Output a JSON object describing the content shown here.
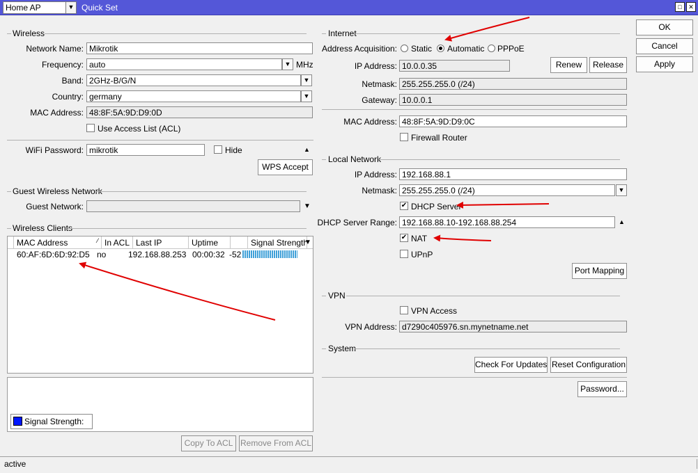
{
  "titlebar": {
    "mode": "Home AP",
    "title": "Quick Set"
  },
  "actions": {
    "ok": "OK",
    "cancel": "Cancel",
    "apply": "Apply"
  },
  "wireless": {
    "section": "Wireless",
    "network_name_label": "Network Name:",
    "network_name": "Mikrotik",
    "frequency_label": "Frequency:",
    "frequency": "auto",
    "frequency_unit": "MHz",
    "band_label": "Band:",
    "band": "2GHz-B/G/N",
    "country_label": "Country:",
    "country": "germany",
    "mac_label": "MAC Address:",
    "mac": "48:8F:5A:9D:D9:0D",
    "acl_label": "Use Access List (ACL)",
    "wifi_password_label": "WiFi Password:",
    "wifi_password": "mikrotik",
    "hide_label": "Hide",
    "wps_button": "WPS Accept"
  },
  "guest": {
    "section": "Guest Wireless Network",
    "network_label": "Guest Network:",
    "network": ""
  },
  "clients": {
    "section": "Wireless Clients",
    "columns": [
      "MAC Address",
      "In ACL",
      "Last IP",
      "Uptime",
      "",
      "Signal Strength"
    ],
    "rows": [
      {
        "mac": "60:AF:6D:6D:92:D5",
        "in_acl": "no",
        "last_ip": "192.168.88.253",
        "uptime": "00:00:32",
        "signal": "-52",
        "signal_bar": 0.9
      }
    ],
    "legend": "Signal Strength:",
    "copy_acl": "Copy To ACL",
    "remove_acl": "Remove From ACL"
  },
  "internet": {
    "section": "Internet",
    "acquisition_label": "Address Acquisition:",
    "options": [
      "Static",
      "Automatic",
      "PPPoE"
    ],
    "selected": "Automatic",
    "ip_label": "IP Address:",
    "ip": "10.0.0.35",
    "renew": "Renew",
    "release": "Release",
    "netmask_label": "Netmask:",
    "netmask": "255.255.255.0 (/24)",
    "gateway_label": "Gateway:",
    "gateway": "10.0.0.1",
    "mac_label": "MAC Address:",
    "mac": "48:8F:5A:9D:D9:0C",
    "firewall_label": "Firewall Router"
  },
  "local": {
    "section": "Local Network",
    "ip_label": "IP Address:",
    "ip": "192.168.88.1",
    "netmask_label": "Netmask:",
    "netmask": "255.255.255.0 (/24)",
    "dhcp_label": "DHCP Server",
    "dhcp_range_label": "DHCP Server Range:",
    "dhcp_range": "192.168.88.10-192.168.88.254",
    "nat_label": "NAT",
    "upnp_label": "UPnP",
    "port_mapping": "Port Mapping"
  },
  "vpn": {
    "section": "VPN",
    "access_label": "VPN Access",
    "address_label": "VPN Address:",
    "address": "d7290c405976.sn.mynetname.net"
  },
  "system": {
    "section": "System",
    "check_updates": "Check For Updates",
    "reset": "Reset Configuration",
    "password": "Password..."
  },
  "status": {
    "text": "active"
  },
  "colors": {
    "titlebar": "#5457d8",
    "annotation_arrow": "#e00000",
    "signal": "#3fa0d8",
    "legend_swatch": "#0018ff"
  }
}
